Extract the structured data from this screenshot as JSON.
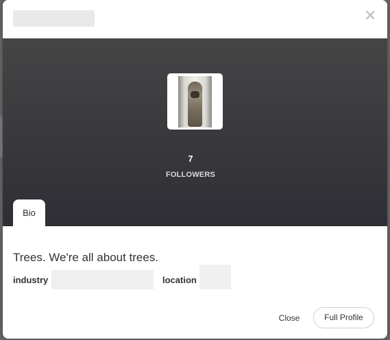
{
  "modal": {
    "close_icon": "×",
    "avatar": {
      "icon": "profile-avatar-image"
    },
    "stats": {
      "followers_count": "7",
      "followers_label": "FOLLOWERS"
    },
    "tabs": [
      {
        "label": "Bio",
        "active": true
      }
    ],
    "bio": {
      "text": "Trees. We're all about trees.",
      "industry_label": "industry",
      "location_label": "location"
    },
    "footer": {
      "close_label": "Close",
      "full_profile_label": "Full Profile"
    }
  },
  "colors": {
    "hero_top": "#454546",
    "hero_bottom": "#2f2e35",
    "modal_bg": "#ffffff"
  }
}
